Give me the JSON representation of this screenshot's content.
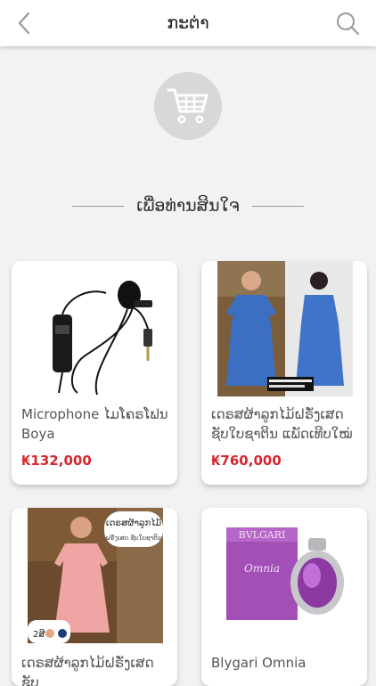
{
  "header": {
    "title": "ກະຕ່າ",
    "back_icon": "chevron-left-icon",
    "search_icon": "search-icon"
  },
  "empty_cart_icon": "shopping-cart-icon",
  "section_title": "ເພື່ອທ່ານສິນໃຈ",
  "colors": {
    "price": "#d7262e",
    "background": "#f2f2f2",
    "icon_gray": "#9a9a9a"
  },
  "products": [
    {
      "name": "Microphone ໄມໂຄຣໂຟນ Boya",
      "price": "₭132,000"
    },
    {
      "name": "ເດຣສຜ້າລູກໄມ້ຝຣັ່ງເສດ ຊັບໃບຊາຕິນ ແພັດເທີບໃໝ່ ງາ...",
      "price": "₭760,000"
    },
    {
      "name": "ເດຣສຜ້າລູກໄມ້ຝຣັ່ງເສດ ຊັບ",
      "price": ""
    },
    {
      "name": "Blygari Omnia",
      "price": ""
    }
  ],
  "image_texts": {
    "dress_banner": "ເດຣສຜ້າລູກໄມ້",
    "dress_banner_sub": "ຝຣັ່ງເສດ ຊັບໃບຊາຕິນ",
    "colors_count": "2ສີ",
    "perfume_brand": "BVLGARI",
    "perfume_name": "Omnia"
  }
}
